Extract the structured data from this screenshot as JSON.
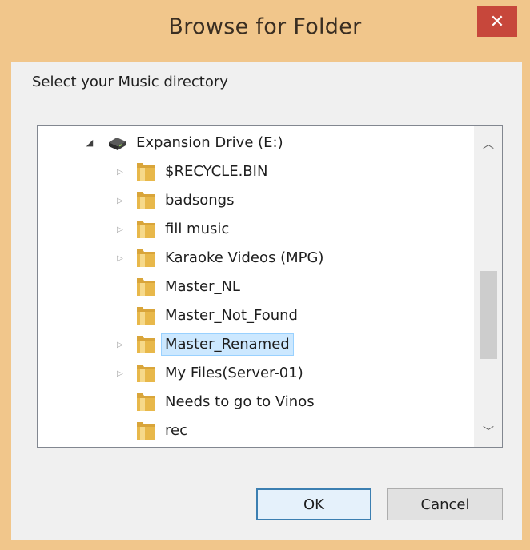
{
  "window": {
    "title": "Browse for Folder",
    "close_glyph": "✕"
  },
  "dialog": {
    "instruction": "Select your Music directory"
  },
  "tree": {
    "root": {
      "label": "Expansion Drive (E:)",
      "icon": "drive-icon",
      "expanded": true
    },
    "items": [
      {
        "label": "$RECYCLE.BIN",
        "has_children": true,
        "selected": false
      },
      {
        "label": "badsongs",
        "has_children": true,
        "selected": false
      },
      {
        "label": "fill music",
        "has_children": true,
        "selected": false
      },
      {
        "label": "Karaoke Videos (MPG)",
        "has_children": true,
        "selected": false
      },
      {
        "label": "Master_NL",
        "has_children": false,
        "selected": false
      },
      {
        "label": "Master_Not_Found",
        "has_children": false,
        "selected": false
      },
      {
        "label": "Master_Renamed",
        "has_children": true,
        "selected": true
      },
      {
        "label": "My Files(Server-01)",
        "has_children": true,
        "selected": false
      },
      {
        "label": "Needs to go to Vinos",
        "has_children": false,
        "selected": false
      },
      {
        "label": "rec",
        "has_children": false,
        "selected": false
      }
    ],
    "scroll_position": 0.55
  },
  "buttons": {
    "ok": "OK",
    "cancel": "Cancel"
  },
  "colors": {
    "title_bar": "#f1c68b",
    "close_button": "#c7473b",
    "selection": "#cce8ff",
    "folder": "#e8b84a"
  }
}
